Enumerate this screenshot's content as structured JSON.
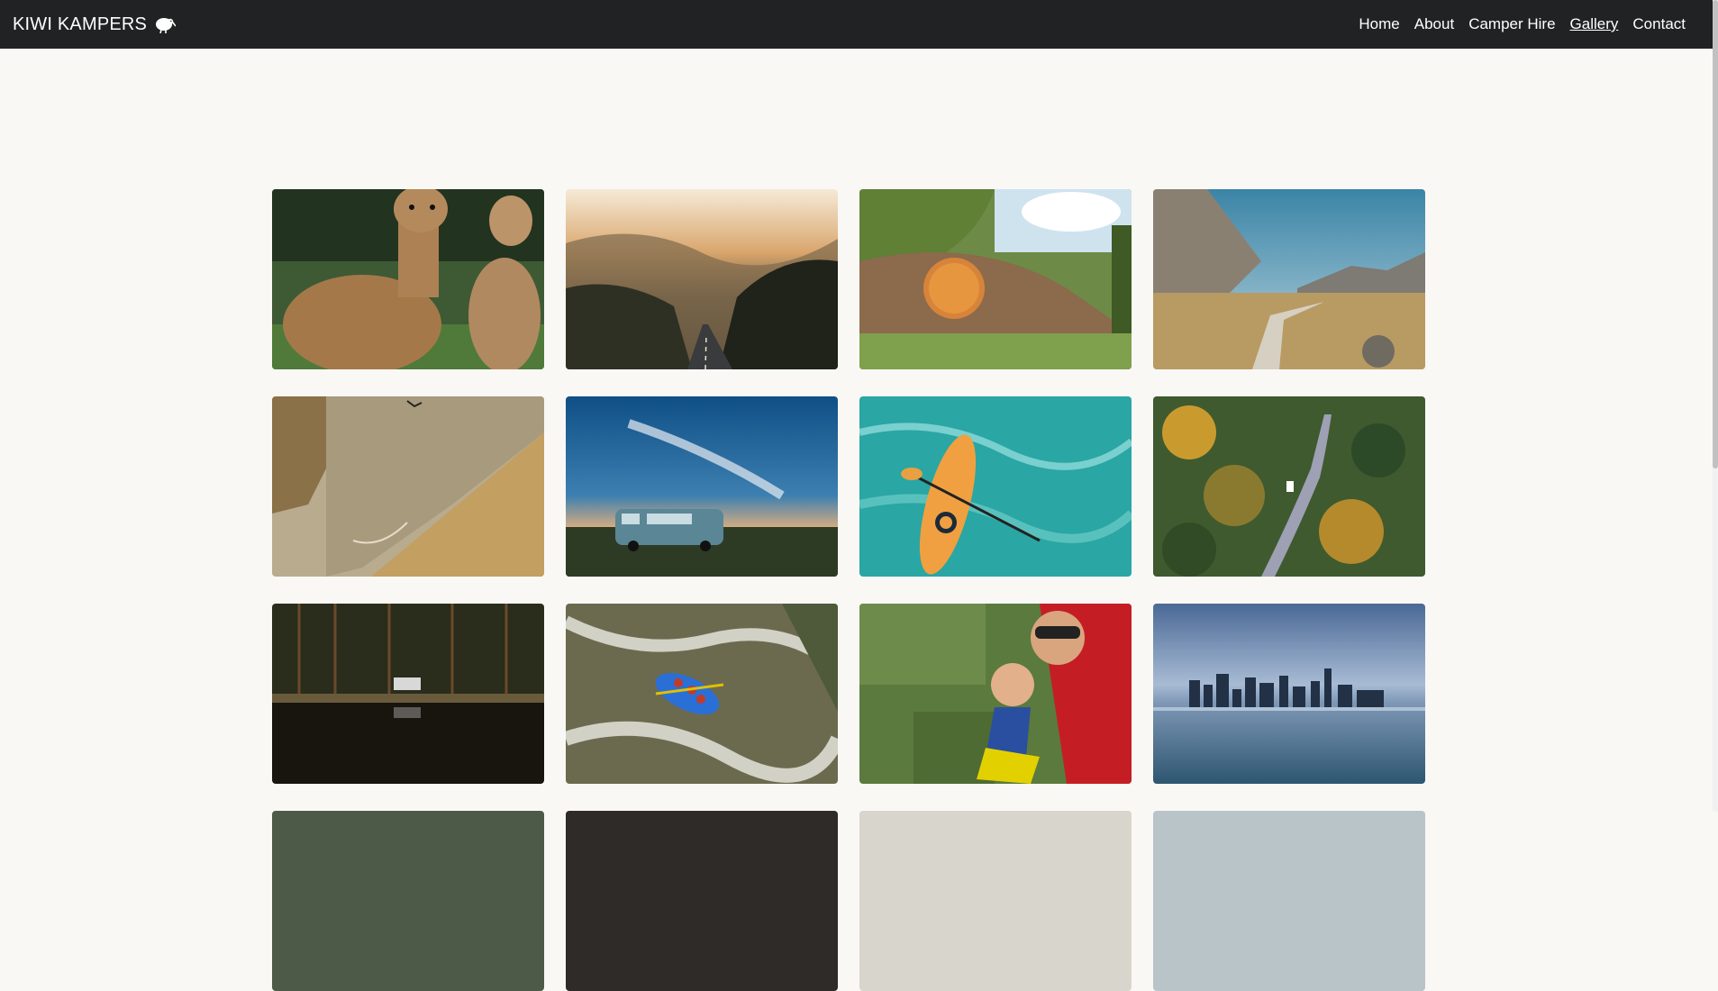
{
  "navbar": {
    "brand": "KIWI KAMPERS",
    "brand_icon": "kiwi-bird-icon",
    "links": [
      {
        "label": "Home",
        "active": false
      },
      {
        "label": "About",
        "active": false
      },
      {
        "label": "Camper Hire",
        "active": false
      },
      {
        "label": "Gallery",
        "active": true
      },
      {
        "label": "Contact",
        "active": false
      }
    ]
  },
  "gallery": {
    "photos": [
      {
        "subject": "alpacas"
      },
      {
        "subject": "misty-road-sunrise"
      },
      {
        "subject": "hobbit-hole-door"
      },
      {
        "subject": "mountain-boardwalk"
      },
      {
        "subject": "canyon-valley"
      },
      {
        "subject": "campervan-sunset"
      },
      {
        "subject": "kayaker-rapids"
      },
      {
        "subject": "forest-road-aerial"
      },
      {
        "subject": "forest-lake-camper"
      },
      {
        "subject": "whitewater-rafting"
      },
      {
        "subject": "tandem-skydive"
      },
      {
        "subject": "city-skyline-water"
      },
      {
        "subject": "partial-row"
      },
      {
        "subject": "partial-row"
      },
      {
        "subject": "partial-row"
      },
      {
        "subject": "partial-row"
      }
    ]
  },
  "colors": {
    "navbar_bg": "#212223",
    "page_bg": "#f9f8f5",
    "nav_text": "#ffffff"
  }
}
